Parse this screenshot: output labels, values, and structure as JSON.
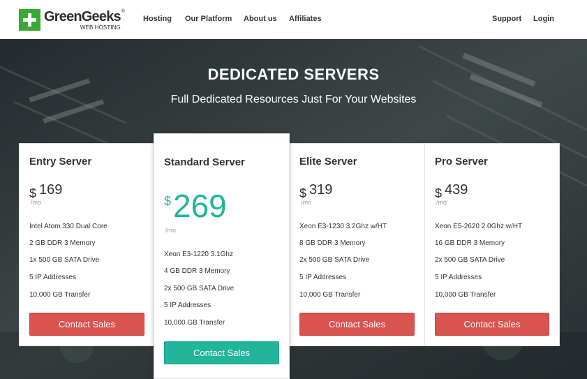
{
  "brand": {
    "name": "GreenGeeks",
    "reg": "®",
    "tagline": "WEB HOSTING",
    "color": "#39a935"
  },
  "nav": {
    "hosting": "Hosting",
    "platform": "Our Platform",
    "about": "About us",
    "affiliates": "Affiliates",
    "support": "Support",
    "login": "Login"
  },
  "hero": {
    "title": "DEDICATED SERVERS",
    "subtitle": "Full Dedicated Resources Just For Your Websites"
  },
  "colors": {
    "accent_green": "#21b59b",
    "button_red": "#d9534f"
  },
  "plans": [
    {
      "name": "Entry Server",
      "currency": "$",
      "price": "169",
      "period": "/mo",
      "features": [
        "Intel Atom 330 Dual Core",
        "2 GB DDR 3 Memory",
        "1x 500 GB SATA Drive",
        "5 IP Addresses",
        "10,000 GB Transfer"
      ],
      "cta": "Contact Sales"
    },
    {
      "name": "Standard Server",
      "currency": "$",
      "price": "269",
      "period": "/mo",
      "featured": true,
      "features": [
        "Xeon E3-1220 3.1Ghz",
        "4 GB DDR 3 Memory",
        "2x 500 GB SATA Drive",
        "5 IP Addresses",
        "10,000 GB Transfer"
      ],
      "cta": "Contact Sales"
    },
    {
      "name": "Elite Server",
      "currency": "$",
      "price": "319",
      "period": "/mo",
      "features": [
        "Xeon E3-1230 3.2Ghz w/HT",
        "8 GB DDR 3 Memory",
        "2x 500 GB SATA Drive",
        "5 IP Addresses",
        "10,000 GB Transfer"
      ],
      "cta": "Contact Sales"
    },
    {
      "name": "Pro Server",
      "currency": "$",
      "price": "439",
      "period": "/mo",
      "features": [
        "Xeon E5-2620 2.0Ghz w/HT",
        "16 GB DDR 3 Memory",
        "2x 500 GB SATA Drive",
        "5 IP Addresses",
        "10,000 GB Transfer"
      ],
      "cta": "Contact Sales"
    }
  ]
}
